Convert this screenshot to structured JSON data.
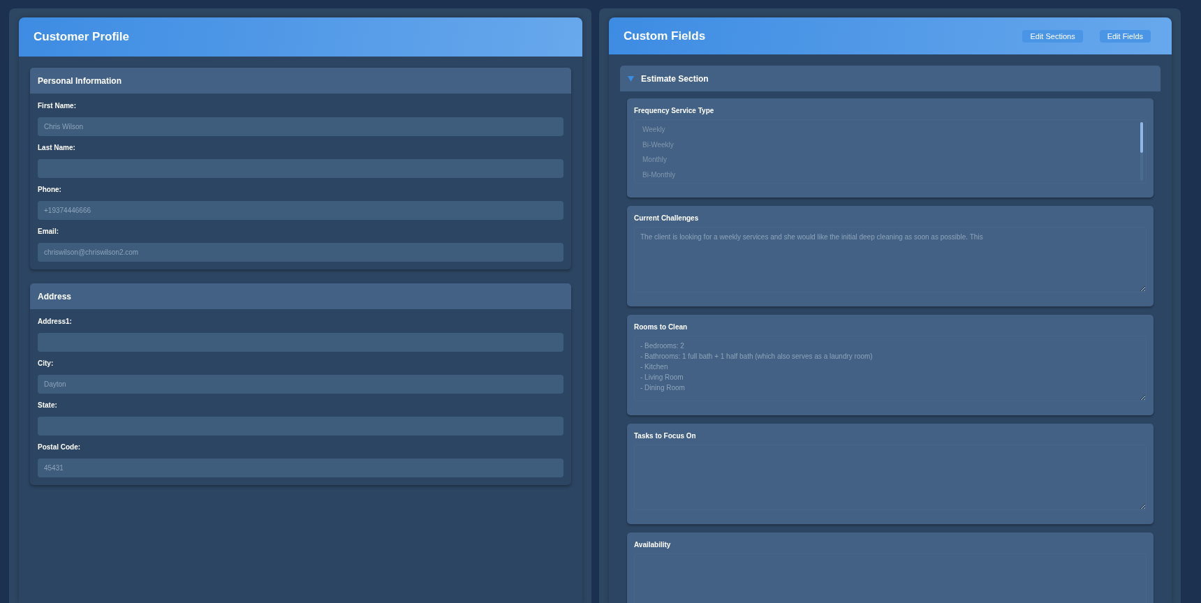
{
  "customer_profile": {
    "title": "Customer Profile",
    "sections": [
      {
        "title": "Personal Information",
        "fields": [
          {
            "label": "First Name:",
            "value": "Chris Wilson"
          },
          {
            "label": "Last Name:"
          },
          {
            "label": "Phone:",
            "value": "+19374446666"
          },
          {
            "label": "Email:",
            "value": "chriswilson@chriswilson2.com"
          }
        ]
      },
      {
        "title": "Address",
        "fields": [
          {
            "label": "Address1:"
          },
          {
            "label": "City:",
            "value": "Dayton"
          },
          {
            "label": "State:"
          },
          {
            "label": "Postal Code:",
            "value": "45431"
          }
        ]
      }
    ]
  },
  "custom_fields": {
    "title": "Custom Fields",
    "buttons": [
      "Edit Sections",
      "Edit Fields"
    ],
    "section": {
      "title": "Estimate Section",
      "expanded": true,
      "fields": [
        {
          "kind": "listbox",
          "label": "Frequency Service Type",
          "options": [
            "Weekly",
            "Bi-Weekly",
            "Monthly",
            "Bi-Monthly"
          ]
        },
        {
          "kind": "textarea",
          "label": "Current Challenges",
          "value": "The client is looking for a weekly services and she would like the initial deep cleaning as soon as possible. This"
        },
        {
          "kind": "textarea",
          "label": "Rooms to Clean",
          "value": "- Bedrooms: 2\n- Bathrooms: 1 full bath + 1 half bath (which also serves as a laundry room)\n- Kitchen\n- Living Room\n- Dining Room"
        },
        {
          "kind": "textarea",
          "label": "Tasks to Focus On"
        },
        {
          "kind": "textarea",
          "label": "Availability"
        }
      ]
    }
  }
}
